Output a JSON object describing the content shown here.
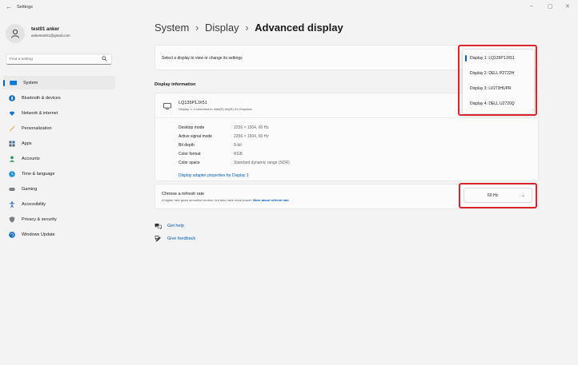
{
  "window": {
    "title": "Settings",
    "back_glyph": "←",
    "controls": [
      "–",
      "▢",
      "✕"
    ]
  },
  "profile": {
    "name": "test01 anker",
    "email": "ankertest01@gmail.com"
  },
  "search": {
    "placeholder": "Find a setting",
    "icon": "search-icon"
  },
  "sidebar": {
    "items": [
      {
        "label": "System",
        "icon": "system-icon",
        "color": "#0078d4",
        "active": true
      },
      {
        "label": "Bluetooth & devices",
        "icon": "bluetooth-icon",
        "color": "#0067c0"
      },
      {
        "label": "Network & internet",
        "icon": "network-icon",
        "color": "#1a73c9"
      },
      {
        "label": "Personalization",
        "icon": "personalization-icon",
        "color": "#e8a33d"
      },
      {
        "label": "Apps",
        "icon": "apps-icon",
        "color": "#586270"
      },
      {
        "label": "Accounts",
        "icon": "accounts-icon",
        "color": "#2e9a5a"
      },
      {
        "label": "Time & language",
        "icon": "time-language-icon",
        "color": "#1f8fd6"
      },
      {
        "label": "Gaming",
        "icon": "gaming-icon",
        "color": "#7a7f86"
      },
      {
        "label": "Accessibility",
        "icon": "accessibility-icon",
        "color": "#1c5fae"
      },
      {
        "label": "Privacy & security",
        "icon": "privacy-icon",
        "color": "#7a7f86"
      },
      {
        "label": "Windows Update",
        "icon": "windows-update-icon",
        "color": "#0a66c2"
      }
    ]
  },
  "breadcrumb": {
    "part1": "System",
    "part2": "Display",
    "current": "Advanced display",
    "separator": "›"
  },
  "display_select": {
    "label": "Select a display to view or change its settings",
    "options": [
      "Display 1: LQ135P1JX51",
      "Display 2: DELL P2722H",
      "Display 3: LV273HUPR",
      "Display 4: DELL U2720Q"
    ],
    "selected_index": 0
  },
  "display_info": {
    "section_title": "Display information",
    "monitor_name": "LQ135P1JX51",
    "monitor_sub": "Display 1: Connected to Intel(R) Iris(R) Xe Graphics",
    "rows": [
      {
        "key": "Desktop mode",
        "value": "2256 × 1504, 60 Hz"
      },
      {
        "key": "Active signal mode",
        "value": "2256 × 1504, 60 Hz"
      },
      {
        "key": "Bit depth",
        "value": "8-bit"
      },
      {
        "key": "Color format",
        "value": "RGB"
      },
      {
        "key": "Color space",
        "value": "Standard dynamic range (SDR)"
      }
    ],
    "adapter_link": "Display adapter properties for Display 1"
  },
  "refresh_rate": {
    "title": "Choose a refresh rate",
    "subtitle": "A higher rate gives smoother motion, but also uses more power",
    "more_link": "More about refresh rate",
    "value": "60 Hz"
  },
  "help_links": {
    "get_help": "Get help",
    "give_feedback": "Give feedback"
  },
  "colors": {
    "accent": "#005fb8",
    "highlight": "#d9262c"
  }
}
